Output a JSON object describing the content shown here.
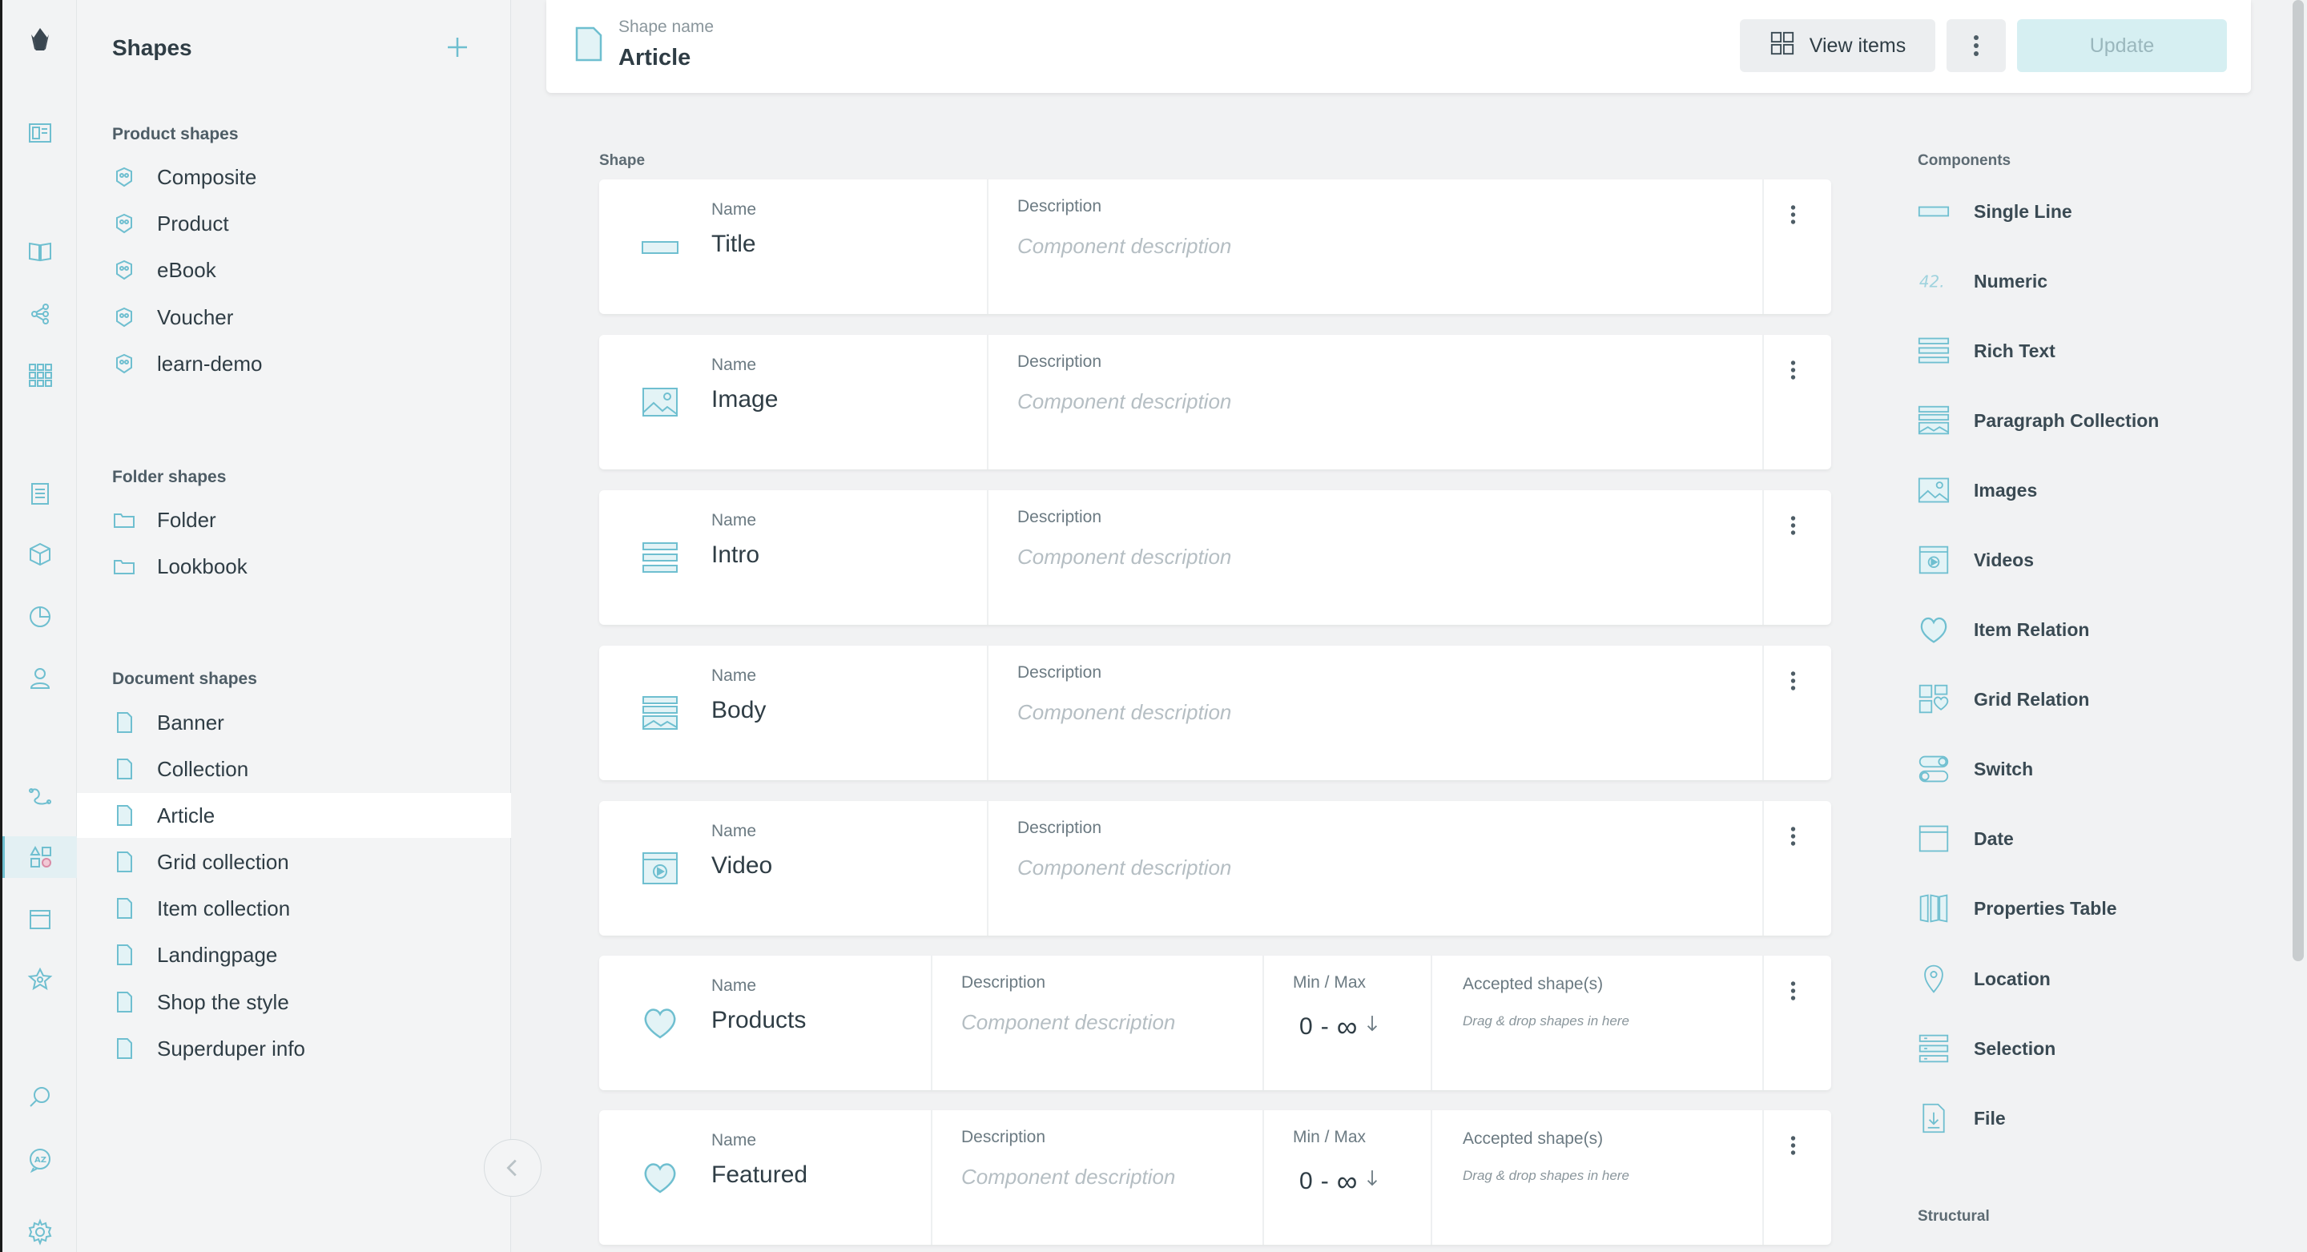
{
  "colors": {
    "accent": "#6fbfd0",
    "update_bg": "#d6eff2",
    "active_bg": "#ffffff"
  },
  "shapes_panel": {
    "title": "Shapes",
    "groups": [
      {
        "title": "Product shapes",
        "items": [
          "Composite",
          "Product",
          "eBook",
          "Voucher",
          "learn-demo"
        ]
      },
      {
        "title": "Folder shapes",
        "items": [
          "Folder",
          "Lookbook"
        ]
      },
      {
        "title": "Document shapes",
        "items": [
          "Banner",
          "Collection",
          "Article",
          "Grid collection",
          "Item collection",
          "Landingpage",
          "Shop the style",
          "Superduper info"
        ]
      }
    ],
    "active_item": "Article"
  },
  "topbar": {
    "shape_name_label": "Shape name",
    "shape_name_value": "Article",
    "view_items_label": "View items",
    "update_label": "Update"
  },
  "shape_section_label": "Shape",
  "components_section_label": "Components",
  "structural_section_label": "Structural",
  "shape_components": [
    {
      "name_label": "Name",
      "name": "Title",
      "desc_label": "Description",
      "desc_placeholder": "Component description",
      "icon": "single-line-icon"
    },
    {
      "name_label": "Name",
      "name": "Image",
      "desc_label": "Description",
      "desc_placeholder": "Component description",
      "icon": "images-icon"
    },
    {
      "name_label": "Name",
      "name": "Intro",
      "desc_label": "Description",
      "desc_placeholder": "Component description",
      "icon": "rich-text-icon"
    },
    {
      "name_label": "Name",
      "name": "Body",
      "desc_label": "Description",
      "desc_placeholder": "Component description",
      "icon": "paragraph-collection-icon"
    },
    {
      "name_label": "Name",
      "name": "Video",
      "desc_label": "Description",
      "desc_placeholder": "Component description",
      "icon": "videos-icon"
    },
    {
      "name_label": "Name",
      "name": "Products",
      "desc_label": "Description",
      "desc_placeholder": "Component description",
      "icon": "item-relation-icon",
      "minmax_label": "Min / Max",
      "min": "0",
      "sep": "-",
      "max": "∞",
      "accepted_label": "Accepted shape(s)",
      "accepted_hint": "Drag & drop shapes in here"
    },
    {
      "name_label": "Name",
      "name": "Featured",
      "desc_label": "Description",
      "desc_placeholder": "Component description",
      "icon": "item-relation-icon",
      "minmax_label": "Min / Max",
      "min": "0",
      "sep": "-",
      "max": "∞",
      "accepted_label": "Accepted shape(s)",
      "accepted_hint": "Drag & drop shapes in here"
    }
  ],
  "components": [
    {
      "label": "Single Line",
      "icon": "single-line-icon"
    },
    {
      "label": "Numeric",
      "icon": "numeric-icon"
    },
    {
      "label": "Rich Text",
      "icon": "rich-text-icon"
    },
    {
      "label": "Paragraph Collection",
      "icon": "paragraph-collection-icon"
    },
    {
      "label": "Images",
      "icon": "images-icon"
    },
    {
      "label": "Videos",
      "icon": "videos-icon"
    },
    {
      "label": "Item Relation",
      "icon": "item-relation-icon"
    },
    {
      "label": "Grid Relation",
      "icon": "grid-relation-icon"
    },
    {
      "label": "Switch",
      "icon": "switch-icon"
    },
    {
      "label": "Date",
      "icon": "date-icon"
    },
    {
      "label": "Properties Table",
      "icon": "properties-table-icon"
    },
    {
      "label": "Location",
      "icon": "location-icon"
    },
    {
      "label": "Selection",
      "icon": "selection-icon"
    },
    {
      "label": "File",
      "icon": "file-icon"
    }
  ],
  "numeric_icon_text": "42."
}
